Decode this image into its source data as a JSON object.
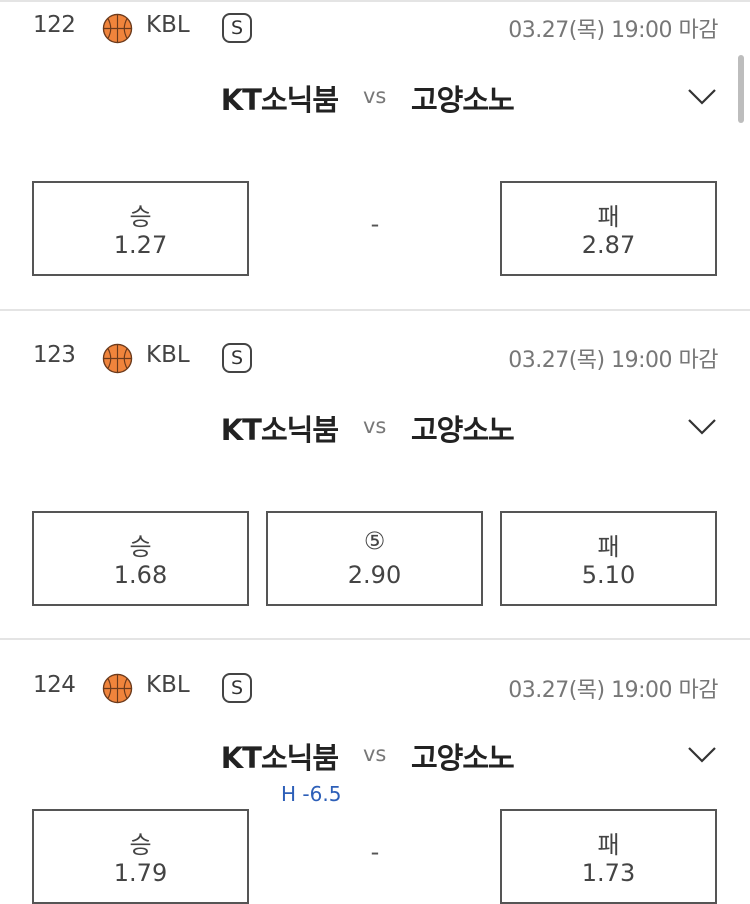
{
  "games": [
    {
      "number": "122",
      "league": "KBL",
      "badge": "S",
      "deadline": "03.27(목) 19:00 마감",
      "home_team": "KT소닉붐",
      "vs": "vs",
      "away_team": "고양소노",
      "handicap": "",
      "odds": {
        "win": {
          "label": "승",
          "value": "1.27"
        },
        "draw": "-",
        "lose": {
          "label": "패",
          "value": "2.87"
        }
      }
    },
    {
      "number": "123",
      "league": "KBL",
      "badge": "S",
      "deadline": "03.27(목) 19:00 마감",
      "home_team": "KT소닉붐",
      "vs": "vs",
      "away_team": "고양소노",
      "handicap": "",
      "odds": {
        "win": {
          "label": "승",
          "value": "1.68"
        },
        "draw": {
          "label": "⑤",
          "value": "2.90"
        },
        "lose": {
          "label": "패",
          "value": "5.10"
        }
      }
    },
    {
      "number": "124",
      "league": "KBL",
      "badge": "S",
      "deadline": "03.27(목) 19:00 마감",
      "home_team": "KT소닉붐",
      "vs": "vs",
      "away_team": "고양소노",
      "handicap": "H -6.5",
      "odds": {
        "win": {
          "label": "승",
          "value": "1.79"
        },
        "draw": "-",
        "lose": {
          "label": "패",
          "value": "1.73"
        }
      }
    }
  ],
  "icons": {
    "league_icon": "basketball-icon",
    "expand_icon": "chevron-down-icon"
  },
  "colors": {
    "handicap": "#2d5fb8",
    "border": "#555555",
    "divider": "#e4e4e4"
  }
}
